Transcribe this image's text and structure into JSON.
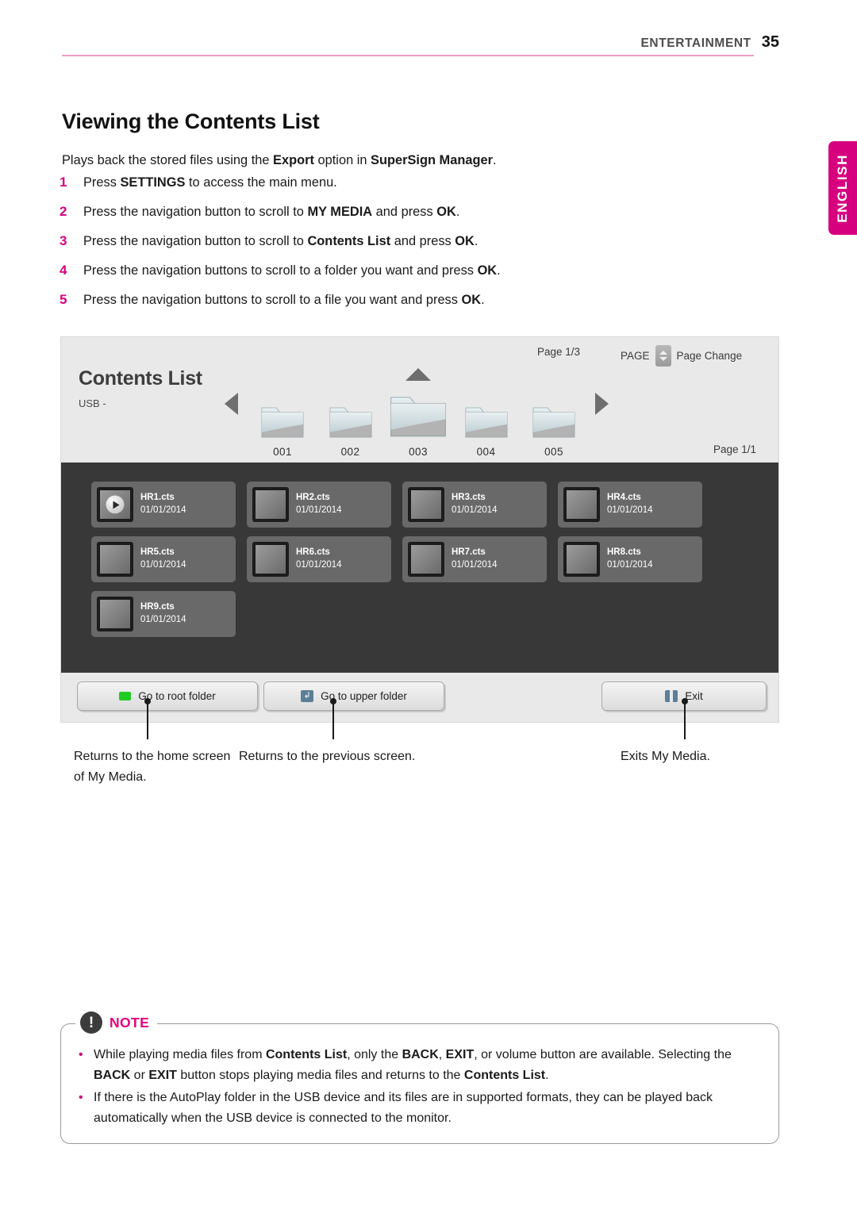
{
  "colors": {
    "accent_magenta": "#D6007F",
    "rule_pink": "#E79EC4",
    "note_label": "#E4007F",
    "screen_dark": "#383838",
    "screen_light": "#E9E9E9"
  },
  "header": {
    "chapter": "ENTERTAINMENT",
    "page_number": "35"
  },
  "language_tab": {
    "label": "ENGLISH"
  },
  "section": {
    "title": "Viewing the Contents List",
    "intro_parts": {
      "a": "Plays back the stored files using the ",
      "b": "Export",
      "c": " option in ",
      "d": "SuperSign Manager",
      "e": "."
    }
  },
  "steps": [
    {
      "num": "1",
      "a": "Press ",
      "b": "SETTINGS",
      "c": " to access the main menu.",
      "d": "",
      "e": ""
    },
    {
      "num": "2",
      "a": "Press the navigation button to scroll to ",
      "b": "MY MEDIA",
      "c": " and press ",
      "d": "OK",
      "e": "."
    },
    {
      "num": "3",
      "a": "Press the navigation button to scroll to ",
      "b": "Contents List",
      "c": " and press ",
      "d": "OK",
      "e": "."
    },
    {
      "num": "4",
      "a": "Press the navigation buttons to scroll to a folder you want and press ",
      "b": "",
      "c": "",
      "d": "OK",
      "e": "."
    },
    {
      "num": "5",
      "a": "Press the navigation buttons to scroll to a file you want and press ",
      "b": "",
      "c": "",
      "d": "OK",
      "e": "."
    }
  ],
  "mockup": {
    "title": "Contents List",
    "source": "USB -",
    "nav_prev_icon": "triangle-left-icon",
    "nav_next_icon": "triangle-right-icon",
    "selected_marker_icon": "triangle-up-icon",
    "folders": [
      {
        "label": "001",
        "selected": false
      },
      {
        "label": "002",
        "selected": false
      },
      {
        "label": "003",
        "selected": true
      },
      {
        "label": "004",
        "selected": false
      },
      {
        "label": "005",
        "selected": false
      }
    ],
    "page_top": "Page 1/3",
    "page_control_label": "PAGE",
    "page_change_label": "Page Change",
    "page_bottom": "Page 1/1",
    "files": [
      {
        "name": "HR1.cts",
        "date": "01/01/2014",
        "playing": true
      },
      {
        "name": "HR2.cts",
        "date": "01/01/2014",
        "playing": false
      },
      {
        "name": "HR3.cts",
        "date": "01/01/2014",
        "playing": false
      },
      {
        "name": "HR4.cts",
        "date": "01/01/2014",
        "playing": false
      },
      {
        "name": "HR5.cts",
        "date": "01/01/2014",
        "playing": false
      },
      {
        "name": "HR6.cts",
        "date": "01/01/2014",
        "playing": false
      },
      {
        "name": "HR7.cts",
        "date": "01/01/2014",
        "playing": false
      },
      {
        "name": "HR8.cts",
        "date": "01/01/2014",
        "playing": false
      },
      {
        "name": "HR9.cts",
        "date": "01/01/2014",
        "playing": false
      }
    ],
    "buttons": {
      "root": {
        "label": "Go to root folder",
        "icon": "green-square-icon"
      },
      "upper": {
        "label": "Go to upper folder",
        "icon": "back-arrow-icon"
      },
      "exit": {
        "label": "Exit",
        "icon": "exit-icon"
      }
    }
  },
  "captions": {
    "root": "Returns to the home screen of My Media.",
    "upper": "Returns to the previous screen.",
    "exit": "Exits My Media."
  },
  "note": {
    "label": "NOTE",
    "icon": "exclamation-icon",
    "items": [
      {
        "p1": "While playing media files from ",
        "b1": "Contents List",
        "p2": ", only the ",
        "b2": "BACK",
        "p3": ", ",
        "b3": "EXIT",
        "p4": ", or volume button are available. Selecting the ",
        "b4": "BACK",
        "p5": " or ",
        "b5": "EXIT",
        "p6": " button stops playing media files and returns to the ",
        "b6": "Contents List",
        "p7": "."
      },
      {
        "p1": "If there is the AutoPlay folder in the USB device and its files are in supported formats, they can be played back automatically when the USB device is connected to the monitor.",
        "b1": "",
        "p2": "",
        "b2": "",
        "p3": "",
        "b3": "",
        "p4": "",
        "b4": "",
        "p5": "",
        "b5": "",
        "p6": "",
        "b6": "",
        "p7": ""
      }
    ]
  }
}
